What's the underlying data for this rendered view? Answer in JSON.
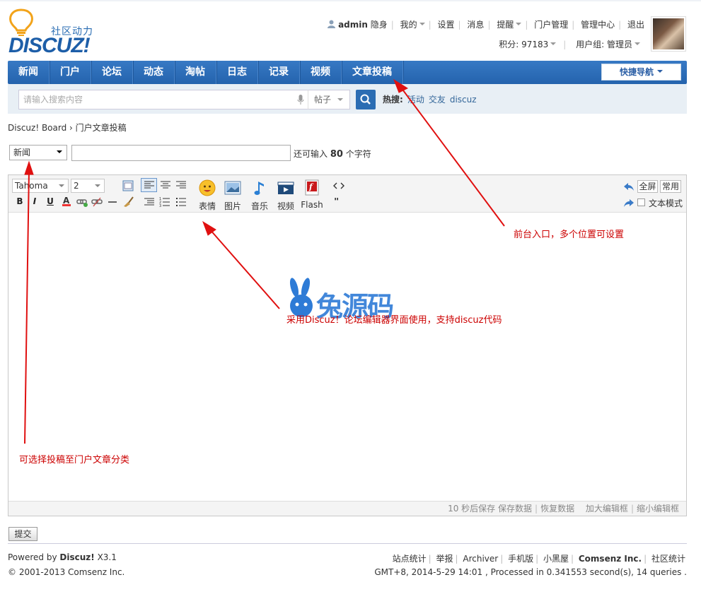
{
  "site": {
    "logo_cn": "社区动力",
    "logo_en": "DISCUZ!"
  },
  "user": {
    "name": "admin",
    "status": "隐身",
    "my": "我的",
    "settings": "设置",
    "messages": "消息",
    "remind": "提醒",
    "portal_admin": "门户管理",
    "admin_center": "管理中心",
    "logout": "退出",
    "credits": "积分: 97183",
    "group": "用户组: 管理员"
  },
  "nav": {
    "items": [
      "新闻",
      "门户",
      "论坛",
      "动态",
      "淘帖",
      "日志",
      "记录",
      "视频",
      "文章投稿"
    ],
    "quick": "快捷导航"
  },
  "search": {
    "placeholder": "请输入搜索内容",
    "type": "帖子",
    "hot_label": "热搜:",
    "hot": [
      "活动",
      "交友",
      "discuz"
    ]
  },
  "breadcrumb": "Discuz! Board › 门户文章投稿",
  "form": {
    "category": "新闻",
    "remain_prefix": "还可输入",
    "remain_count": "80",
    "remain_suffix": "个字符",
    "submit": "提交"
  },
  "editor": {
    "font": "Tahoma",
    "size": "2",
    "buttons": {
      "emoji": "表情",
      "image": "图片",
      "music": "音乐",
      "video": "视频",
      "flash": "Flash",
      "fullscreen": "全屏",
      "common": "常用",
      "textmode": "文本模式"
    },
    "footer": {
      "autosave": "10 秒后保存",
      "save": "保存数据",
      "restore": "恢复数据",
      "enlarge": "加大编辑框",
      "shrink": "缩小编辑框"
    }
  },
  "annotations": {
    "a1": "前台入口，多个位置可设置",
    "a2": "采用Discuz！论坛编辑器界面使用，支持discuz代码",
    "a3": "可选择投稿至门户文章分类"
  },
  "watermark": "兔源码",
  "footer": {
    "powered_prefix": "Powered by",
    "powered_name": "Discuz!",
    "powered_ver": "X3.1",
    "copyright": "© 2001-2013 Comsenz Inc.",
    "links": [
      "站点统计",
      "举报",
      "Archiver",
      "手机版",
      "小黑屋"
    ],
    "company": "Comsenz Inc.",
    "stat": "社区统计",
    "gmt": "GMT+8, 2014-5-29 14:01 , Processed in 0.341553 second(s), 14 queries ."
  },
  "colors": {
    "nav": "#2463ad",
    "annotation": "#cc0000",
    "accent": "#2b6db3"
  }
}
